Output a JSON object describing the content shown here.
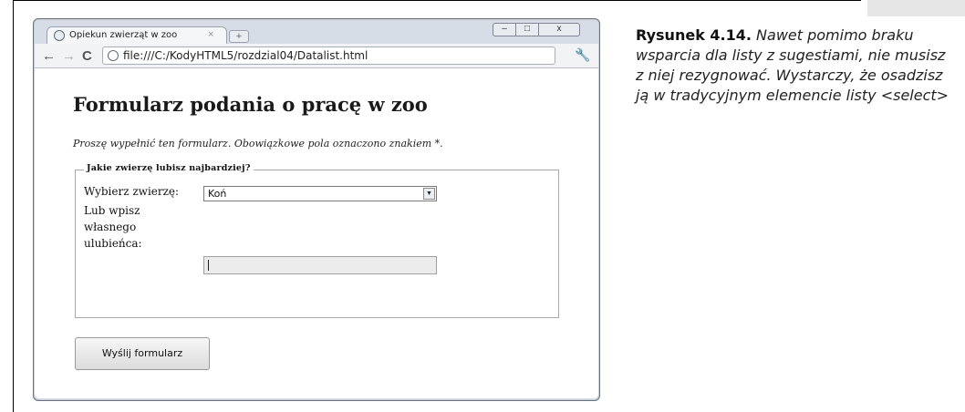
{
  "browser": {
    "tab_title": "Opiekun zwierząt w zoo",
    "tab_close": "×",
    "new_tab": "+",
    "url": "file:///C:/KodyHTML5/rozdzial04/Datalist.html",
    "controls": {
      "minimize": "–",
      "maximize": "□",
      "close": "x"
    }
  },
  "page": {
    "title": "Formularz podania o pracę w zoo",
    "intro": "Proszę wypełnić ten formularz. Obowiązkowe pola oznaczono znakiem *.",
    "fieldset_legend": "Jakie zwierzę lubisz najbardziej?",
    "animal_label": "Wybierz zwierzę:",
    "animal_selected": "Koń",
    "own_label_line1": "Lub wpisz",
    "own_label_line2": "własnego",
    "own_label_line3": "ulubieńca:",
    "own_value": "",
    "submit_label": "Wyślij formularz"
  },
  "caption": {
    "label": "Rysunek 4.14.",
    "text": "Nawet pomimo braku wsparcia dla listy z sugestiami, nie musisz z niej rezygnować. Wystarczy, że osadzisz ją w tradycyjnym elemencie listy <select>"
  },
  "icons": {
    "back": "back-arrow-icon",
    "forward": "forward-arrow-icon",
    "reload": "reload-icon",
    "page": "page-globe-icon",
    "wrench": "wrench-icon",
    "dropdown": "chevron-down-icon"
  }
}
